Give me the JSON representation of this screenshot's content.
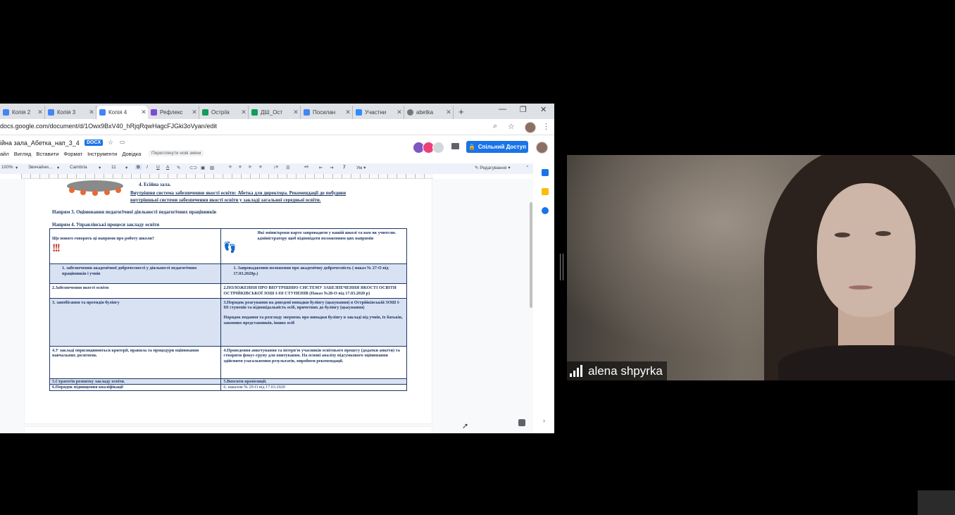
{
  "browser": {
    "tabs": [
      {
        "label": "Копія 2",
        "color": "#4285f4"
      },
      {
        "label": "Копія 3",
        "color": "#4285f4"
      },
      {
        "label": "Копія 4",
        "color": "#4285f4",
        "active": true
      },
      {
        "label": "Рефлекс",
        "color": "#7b4bd6"
      },
      {
        "label": "Остріїк",
        "color": "#0f9d58"
      },
      {
        "label": "ДШ_Ост",
        "color": "#0f9d58"
      },
      {
        "label": "Посилан",
        "color": "#4285f4"
      },
      {
        "label": "Участни",
        "color": "#2d8cff"
      },
      {
        "label": "abetka",
        "color": "#777777"
      }
    ],
    "new_tab": "+",
    "url": "docs.google.com/document/d/1Owx9BxV40_hRjqRqwHagcFJGki3oVyan/edit"
  },
  "docs": {
    "title": "ійна зала_Абетка_нап_3_4",
    "format_badge": "DOCX",
    "menu": [
      "айл",
      "Вигляд",
      "Вставити",
      "Формат",
      "Інструменти",
      "Довідка"
    ],
    "last_edit": "Переглянути нові зміни",
    "share_label": "Спільний Доступ",
    "toolbar": {
      "zoom": "100%",
      "style": "Звичайни...",
      "font": "Cambria",
      "size": "11",
      "mode": "Редагування"
    },
    "content": {
      "item4": "4.   Есійна зала.",
      "link": "Внутрішня система забезпечення якості освіти: Абетка для директора. Рекомендації до побудови",
      "link2": "внутрішньої системи забезпечення якості освіти у закладі загальної середньої освіти.",
      "dir3": "Напрям 3. Оцінювання педагогічної діяльності педагогічних працівників",
      "dir4": "Напрям 4. Управлінські процеси закладу освіти",
      "table": {
        "head_left": "Що нового говорять ці напрями про роботу школи?",
        "head_right": "Які зміни/кроки варто запровадити у вашій школі та вам як учителю. адміністратору щоб відповідати положенням цих напрямів",
        "rows": [
          {
            "left": "1.    забезпечення академічної доброчесності у діяльності педагогічних працівників і учнів",
            "right": "1.    Запровадження положення про академічну доброчесність ( наказ № 27-О від 17.03.2020р.)",
            "blue": true
          },
          {
            "left": "2.Забезпечення якості освіти",
            "right": "2.ПОЛОЖЕННЯ ПРО ВНУТРІШНЮ СИСТЕМУ ЗАБЕЗПЕЧЕННЯ ЯКОСТІ ОСВІТИ ОСТРІЙКІВСЬКОЇ ЗОШ І-ІІІ СТУПЕНІВ (Наказ №28-О від 17.03.2020 р)",
            "blue": false
          },
          {
            "left": "3. запобігання та протидія булінгу",
            "right": "3.Порядок реагування на доведені випадки булінгу (цькування) в Острійківській ЗОШ І-ІІІ ступенів та відповідальність осіб, причетних до булінгу (цькування)",
            "right2": "Порядок подання та розгляду звернень про випадки булінгу в закладі від учнів, їх батьків, законних представників, інших осіб",
            "blue": true
          },
          {
            "left": "4.У закладі оприлюднюються критерії, правила та процедури оцінювання навчальних досягнень",
            "right": "4.Проведення анкетування та інтерв'ю учасників освітнього процесу (додатки анкети) та створити фокус-групу для опитування. На основі аналізу підсумкового оцінювання здійснити узагальнення результатів, виробити рекомендації.",
            "blue": false
          },
          {
            "left": "5.Стратегія розвитку закладу освіти.",
            "right": "5.Вносити пропозиції.",
            "blue": true
          },
          {
            "left": "6.Порядок підвищення кваліфікації",
            "right": "6. наказом № 29-О від 17.03.2020",
            "blue": false
          }
        ]
      }
    }
  },
  "video": {
    "participant_name": "alena shpyrka"
  },
  "colors": {
    "accent": "#1a73e8",
    "doc_text": "#1f3864",
    "table_fill": "#d9e2f3"
  }
}
